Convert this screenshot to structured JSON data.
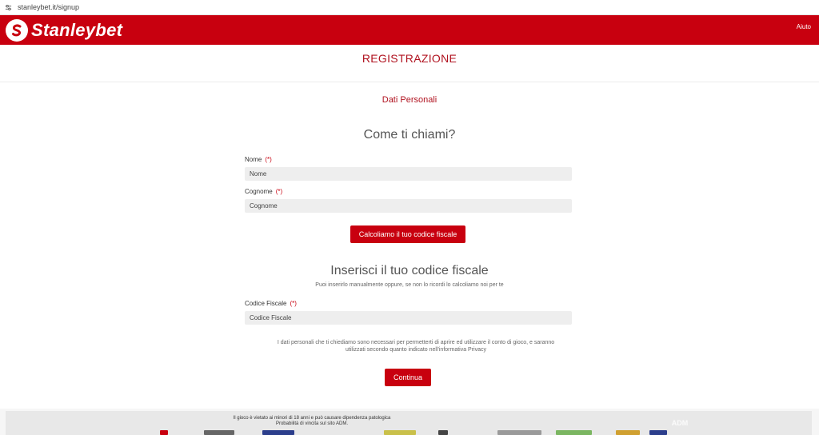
{
  "browser": {
    "url": "stanleybet.it/signup",
    "tune_icon": "site-settings-icon"
  },
  "header": {
    "brand": "Stanleybet",
    "logo_icon": "stanleybet-logo-icon",
    "help_label": "Aiuto",
    "brand_color": "#c8000f"
  },
  "page": {
    "title": "REGISTRAZIONE",
    "section": "Dati Personali"
  },
  "form": {
    "question_name": "Come ti chiami?",
    "nome": {
      "label": "Nome",
      "required": "(*)",
      "placeholder": "Nome",
      "value": ""
    },
    "cognome": {
      "label": "Cognome",
      "required": "(*)",
      "placeholder": "Cognome",
      "value": ""
    },
    "calc_button": "Calcoliamo il tuo codice fiscale",
    "question_cf": "Inserisci il tuo codice fiscale",
    "hint_cf": "Puoi inserirlo manualmente oppure, se non lo ricordi lo calcoliamo noi per te",
    "codice_fiscale": {
      "label": "Codice Fiscale",
      "required": "(*)",
      "placeholder": "Codice Fiscale",
      "value": ""
    },
    "privacy_line1": "I dati personali che ti chiediamo sono necessari per permetterti di aprire ed utilizzare il conto di gioco, e saranno",
    "privacy_line2": "utilizzati secondo quanto indicato nell'informativa Privacy",
    "continue_button": "Continua"
  },
  "footer": {
    "line1": "Il gioco è vietato ai minori di 18 anni e può causare dipendenza patologica",
    "line2": "Probabilità di vincita sul sito ADM.",
    "badge": "ADM"
  }
}
